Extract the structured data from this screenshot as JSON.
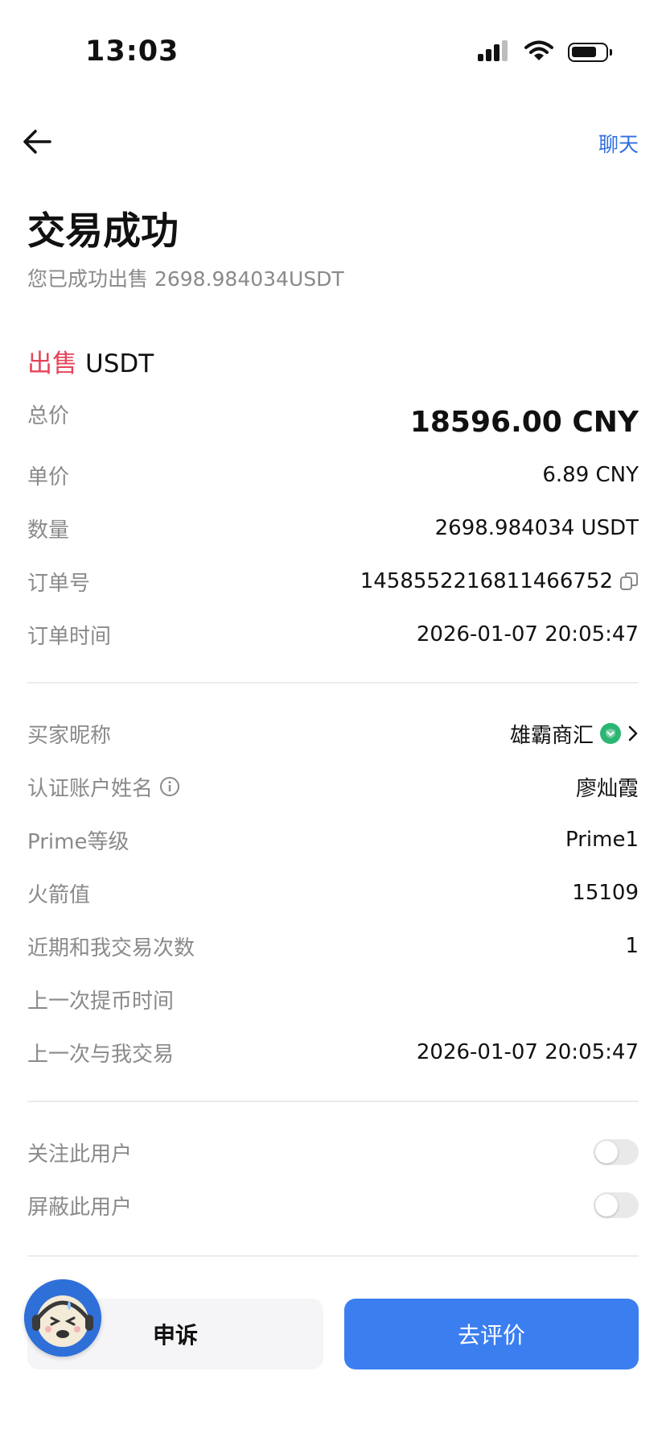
{
  "status_bar": {
    "time": "13:03",
    "icons": [
      "signal-icon",
      "wifi-icon",
      "battery-icon"
    ]
  },
  "nav": {
    "back_icon": "arrow-left-icon",
    "chat_label": "聊天"
  },
  "header": {
    "title": "交易成功",
    "subtitle": "您已成功出售 2698.984034USDT"
  },
  "trade": {
    "side": "出售",
    "coin": "USDT",
    "rows": [
      {
        "label": "总价",
        "value": "18596.00 CNY"
      },
      {
        "label": "单价",
        "value": "6.89 CNY"
      },
      {
        "label": "数量",
        "value": "2698.984034 USDT"
      },
      {
        "label": "订单号",
        "value": "1458552216811466752"
      },
      {
        "label": "订单时间",
        "value": "2026-01-07 20:05:47"
      }
    ]
  },
  "buyer": {
    "rows": [
      {
        "label": "买家昵称",
        "value": "雄霸商汇"
      },
      {
        "label": "认证账户姓名",
        "value": "廖灿霞"
      },
      {
        "label": "Prime等级",
        "value": "Prime1"
      },
      {
        "label": "火箭值",
        "value": "15109"
      },
      {
        "label": "近期和我交易次数",
        "value": "1"
      },
      {
        "label": "上一次提币时间",
        "value": ""
      },
      {
        "label": "上一次与我交易",
        "value": "2026-01-07 20:05:47"
      }
    ]
  },
  "settings": {
    "follow": {
      "label": "关注此用户",
      "enabled": false
    },
    "block": {
      "label": "屏蔽此用户",
      "enabled": false
    }
  },
  "actions": {
    "appeal_label": "申诉",
    "review_label": "去评价"
  },
  "colors": {
    "accent": "#3b7ef0",
    "link": "#2f6fe3",
    "sell": "#e5435a",
    "verified": "#2bb673"
  }
}
